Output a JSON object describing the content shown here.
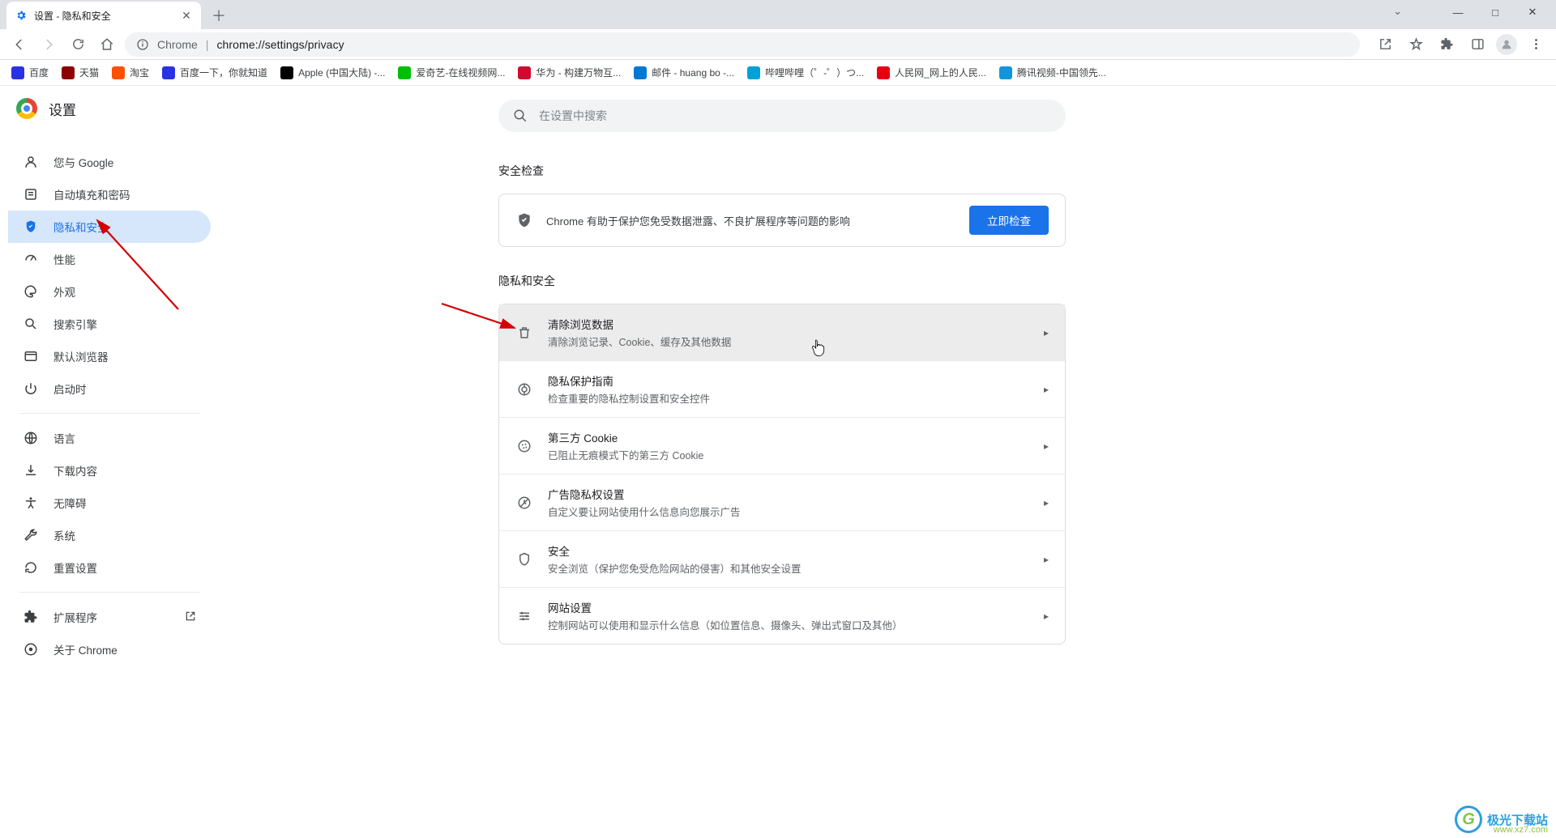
{
  "window": {
    "tab_title": "设置 - 隐私和安全",
    "win_min": "—",
    "win_max": "□",
    "win_close": "✕"
  },
  "toolbar": {
    "scheme_label": "Chrome",
    "url": "chrome://settings/privacy"
  },
  "bookmarks": [
    {
      "label": "百度",
      "color": "#2932e1"
    },
    {
      "label": "天猫",
      "color": "#8b0000"
    },
    {
      "label": "淘宝",
      "color": "#ff5000"
    },
    {
      "label": "百度一下，你就知道",
      "color": "#2932e1"
    },
    {
      "label": "Apple (中国大陆)  -...",
      "color": "#000"
    },
    {
      "label": "爱奇艺-在线视频网...",
      "color": "#00be06"
    },
    {
      "label": "华为 - 构建万物互...",
      "color": "#cf0a2c"
    },
    {
      "label": "邮件 - huang bo -...",
      "color": "#0078d4"
    },
    {
      "label": "哔哩哔哩（゜-゜）つ...",
      "color": "#00a1d6"
    },
    {
      "label": "人民网_网上的人民...",
      "color": "#e60012"
    },
    {
      "label": "腾讯视频-中国领先...",
      "color": "#1296db"
    }
  ],
  "header": {
    "title": "设置"
  },
  "search": {
    "placeholder": "在设置中搜索"
  },
  "sidebar": {
    "items": [
      {
        "icon": "person",
        "label": "您与 Google"
      },
      {
        "icon": "autofill",
        "label": "自动填充和密码"
      },
      {
        "icon": "shield",
        "label": "隐私和安全"
      },
      {
        "icon": "speed",
        "label": "性能"
      },
      {
        "icon": "palette",
        "label": "外观"
      },
      {
        "icon": "search",
        "label": "搜索引擎"
      },
      {
        "icon": "browser",
        "label": "默认浏览器"
      },
      {
        "icon": "power",
        "label": "启动时"
      }
    ],
    "items2": [
      {
        "icon": "globe",
        "label": "语言"
      },
      {
        "icon": "download",
        "label": "下载内容"
      },
      {
        "icon": "a11y",
        "label": "无障碍"
      },
      {
        "icon": "wrench",
        "label": "系统"
      },
      {
        "icon": "reset",
        "label": "重置设置"
      }
    ],
    "items3": [
      {
        "icon": "ext",
        "label": "扩展程序",
        "open": true
      },
      {
        "icon": "about",
        "label": "关于 Chrome"
      }
    ]
  },
  "safetycheck": {
    "title": "安全检查",
    "text": "Chrome 有助于保护您免受数据泄露、不良扩展程序等问题的影响",
    "button": "立即检查"
  },
  "privacy": {
    "title": "隐私和安全",
    "rows": [
      {
        "icon": "trash",
        "title": "清除浏览数据",
        "sub": "清除浏览记录、Cookie、缓存及其他数据"
      },
      {
        "icon": "guide",
        "title": "隐私保护指南",
        "sub": "检查重要的隐私控制设置和安全控件"
      },
      {
        "icon": "cookie",
        "title": "第三方 Cookie",
        "sub": "已阻止无痕模式下的第三方 Cookie"
      },
      {
        "icon": "ads",
        "title": "广告隐私权设置",
        "sub": "自定义要让网站使用什么信息向您展示广告"
      },
      {
        "icon": "security",
        "title": "安全",
        "sub": "安全浏览（保护您免受危险网站的侵害）和其他安全设置"
      },
      {
        "icon": "tune",
        "title": "网站设置",
        "sub": "控制网站可以使用和显示什么信息（如位置信息、摄像头、弹出式窗口及其他）"
      }
    ]
  },
  "watermark": {
    "text": "极光下载站",
    "url": "www.xz7.com"
  }
}
